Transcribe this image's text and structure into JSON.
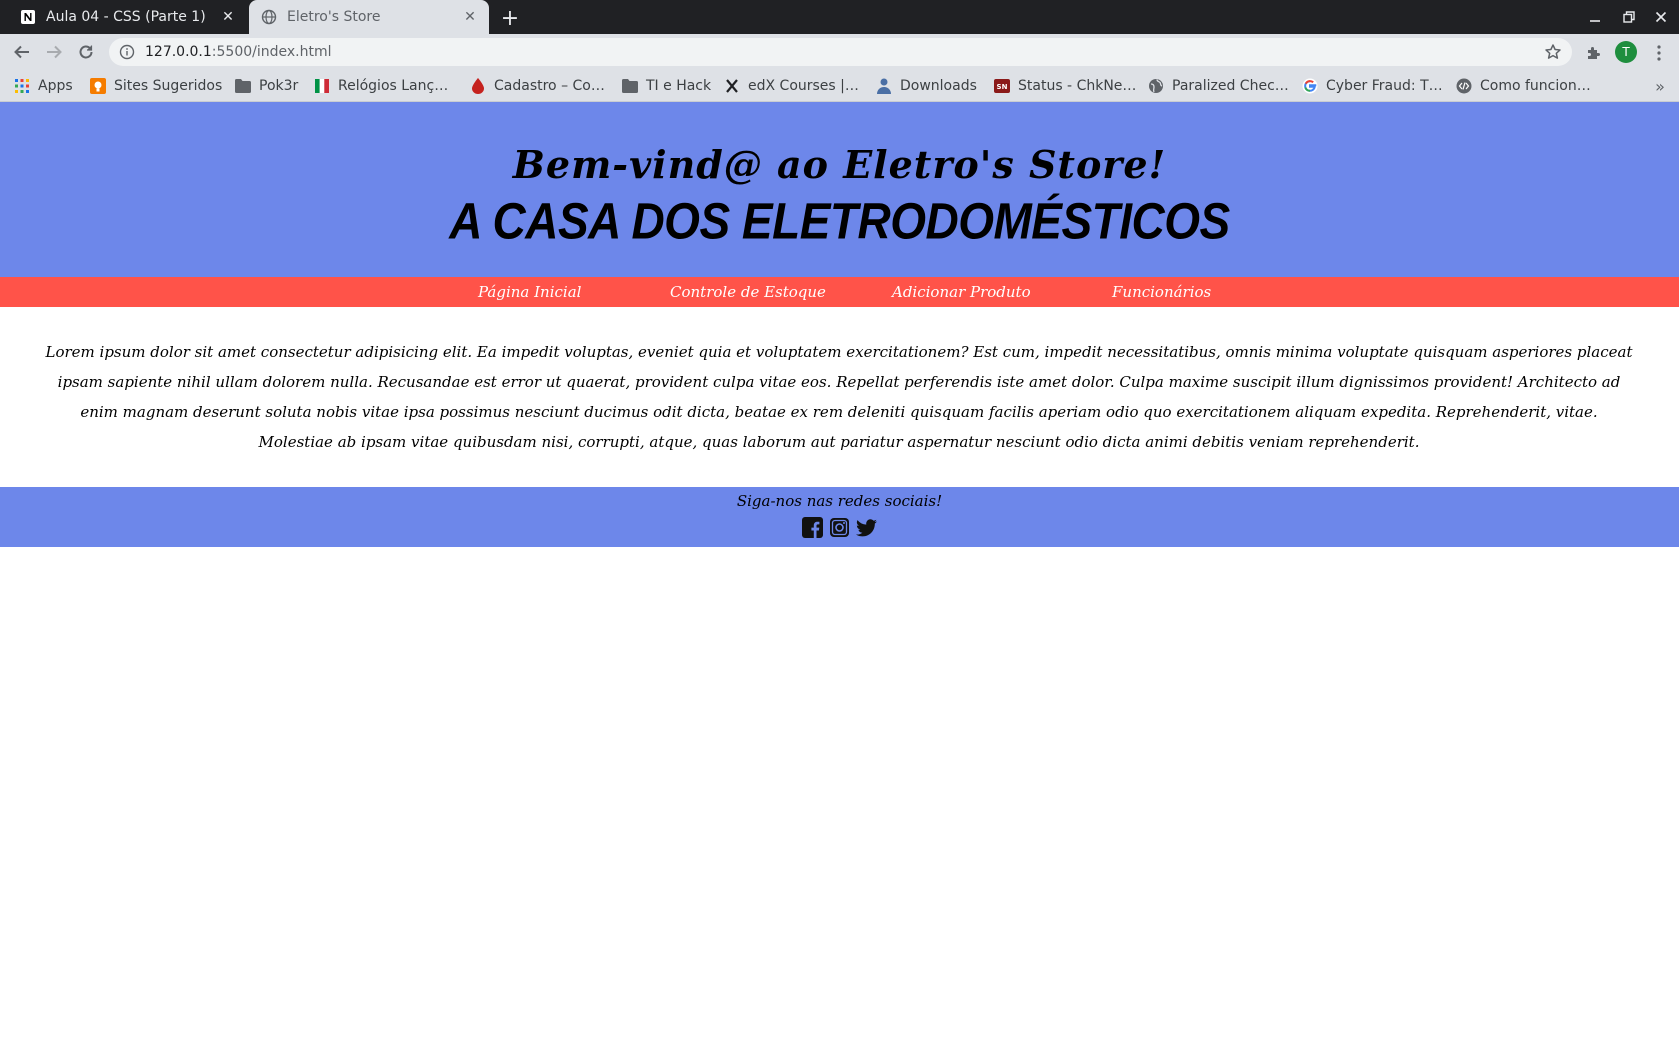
{
  "browser": {
    "tabs": [
      {
        "title": "Aula 04 - CSS (Parte 1)",
        "icon": "notion-icon",
        "active": false
      },
      {
        "title": "Eletro's Store",
        "icon": "globe-icon",
        "active": true
      }
    ],
    "url": {
      "host": "127.0.0.1",
      "rest": ":5500/index.html"
    },
    "profile_initial": "T",
    "bookmarks": [
      {
        "label": "Apps",
        "icon": "apps-grid-icon"
      },
      {
        "label": "Sites Sugeridos",
        "icon": "sites-icon"
      },
      {
        "label": "Pok3r",
        "icon": "folder-icon"
      },
      {
        "label": "Relógios Lanç…",
        "icon": "flag-icon"
      },
      {
        "label": "Cadastro – Co…",
        "icon": "drop-icon"
      },
      {
        "label": "TI e Hack",
        "icon": "folder-icon"
      },
      {
        "label": "edX Courses |…",
        "icon": "edx-icon"
      },
      {
        "label": "Downloads",
        "icon": "person-icon"
      },
      {
        "label": "Status - ChkNe…",
        "icon": "sn-icon"
      },
      {
        "label": "Paralized Chec…",
        "icon": "globe-icon"
      },
      {
        "label": "Cyber Fraud: T…",
        "icon": "google-icon"
      },
      {
        "label": "Como funcion…",
        "icon": "code-icon"
      }
    ],
    "more_label": "»"
  },
  "page": {
    "welcome": "Bem-vind@ ao Eletro's Store!",
    "tagline": "A CASA DOS ELETRODOMÉSTICOS",
    "nav": [
      "Página Inicial",
      "Controle de Estoque",
      "Adicionar Produto",
      "Funcionários"
    ],
    "body_text": "Lorem ipsum dolor sit amet consectetur adipisicing elit. Ea impedit voluptas, eveniet quia et voluptatem exercitationem? Est cum, impedit necessitatibus, omnis minima voluptate quisquam asperiores placeat ipsam sapiente nihil ullam dolorem nulla. Recusandae est error ut quaerat, provident culpa vitae eos. Repellat perferendis iste amet dolor. Culpa maxime suscipit illum dignissimos provident! Architecto ad enim magnam deserunt soluta nobis vitae ipsa possimus nesciunt ducimus odit dicta, beatae ex rem deleniti quisquam facilis aperiam odio quo exercitationem aliquam expedita. Reprehenderit, vitae. Molestiae ab ipsam vitae quibusdam nisi, corrupti, atque, quas laborum aut pariatur aspernatur nesciunt odio dicta animi debitis veniam reprehenderit.",
    "footer_text": "Siga-nos nas redes sociais!",
    "socials": [
      "facebook-icon",
      "instagram-icon",
      "twitter-icon"
    ]
  },
  "colors": {
    "header_blue": "#6d87ea",
    "nav_red": "#ff5349",
    "chrome_dark": "#202124"
  }
}
